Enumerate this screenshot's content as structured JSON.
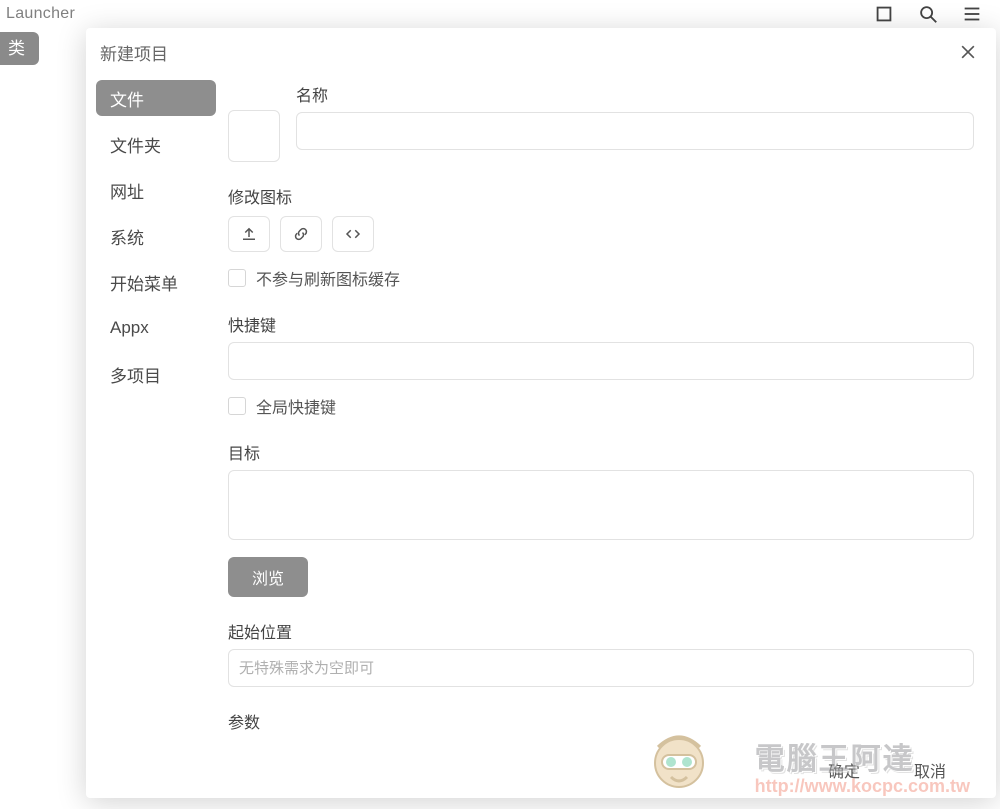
{
  "topbar": {
    "title": "Launcher"
  },
  "left_chip": "类",
  "modal": {
    "title": "新建项目",
    "tabs": [
      "文件",
      "文件夹",
      "网址",
      "系统",
      "开始菜单",
      "Appx",
      "多项目"
    ],
    "form": {
      "name_label": "名称",
      "icon_label": "修改图标",
      "cache_checkbox": "不参与刷新图标缓存",
      "hotkey_label": "快捷键",
      "global_hotkey": "全局快捷键",
      "target_label": "目标",
      "browse": "浏览",
      "startdir_label": "起始位置",
      "startdir_placeholder": "无特殊需求为空即可",
      "params_label": "参数"
    },
    "footer": {
      "ok": "确定",
      "cancel": "取消"
    }
  },
  "watermark": {
    "brand": "電腦王阿達",
    "url": "http://www.kocpc.com.tw"
  }
}
